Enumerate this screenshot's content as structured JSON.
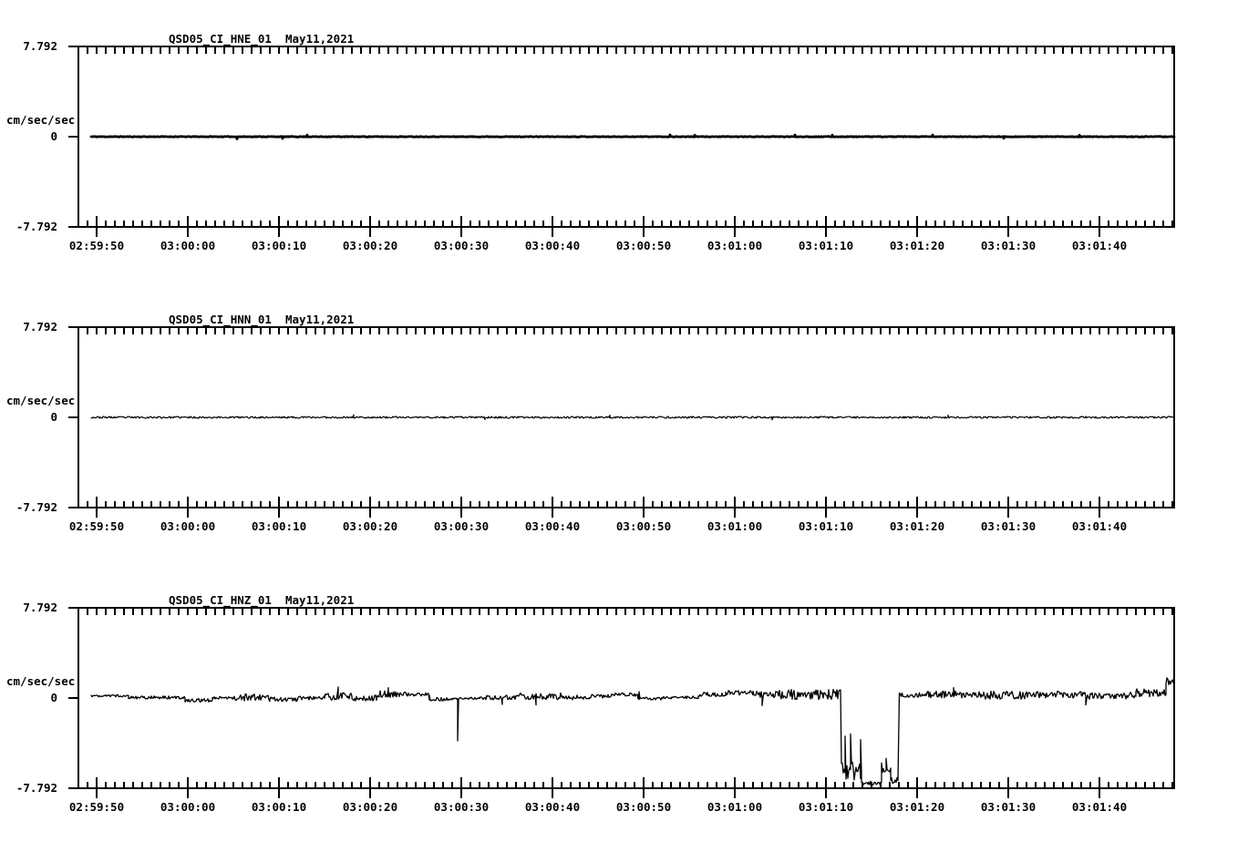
{
  "page": {
    "background": "#ffffff",
    "ink": "#000000"
  },
  "chart_data": [
    {
      "type": "line",
      "station_label": "QSD05_CI_HNE_01",
      "date_label": "May11,2021",
      "ylabel": "cm/sec/sec",
      "ylim": [
        -7.792,
        7.792
      ],
      "ytick_labels": [
        "7.792",
        "0",
        "-7.792"
      ],
      "x_tick_labels": [
        "02:59:50",
        "03:00:00",
        "03:00:10",
        "03:00:20",
        "03:00:30",
        "03:00:40",
        "03:00:50",
        "03:01:00",
        "03:01:10",
        "03:01:20",
        "03:01:30",
        "03:01:40"
      ],
      "x_axis": {
        "span_s": 120.2,
        "major_every_s": 10,
        "minor_every_s": 1,
        "first_major_offset_s": 2
      },
      "grid": false,
      "line_width": 2.8,
      "trace": {
        "segments": [
          [
            1.4,
            120.2,
            0.0,
            0.025
          ]
        ],
        "spikes": [
          [
            17.4,
            -0.2
          ],
          [
            22.4,
            -0.16
          ],
          [
            25.1,
            0.15
          ],
          [
            64.9,
            0.16
          ],
          [
            67.6,
            0.14
          ],
          [
            78.6,
            0.16
          ],
          [
            82.7,
            0.14
          ],
          [
            93.7,
            0.16
          ],
          [
            101.5,
            -0.14
          ],
          [
            109.8,
            0.13
          ]
        ]
      }
    },
    {
      "type": "line",
      "station_label": "QSD05_CI_HNN_01",
      "date_label": "May11,2021",
      "ylabel": "cm/sec/sec",
      "ylim": [
        -7.792,
        7.792
      ],
      "ytick_labels": [
        "7.792",
        "0",
        "-7.792"
      ],
      "x_tick_labels": [
        "02:59:50",
        "03:00:00",
        "03:00:10",
        "03:00:20",
        "03:00:30",
        "03:00:40",
        "03:00:50",
        "03:01:00",
        "03:01:10",
        "03:01:20",
        "03:01:30",
        "03:01:40"
      ],
      "x_axis": {
        "span_s": 120.2,
        "major_every_s": 10,
        "minor_every_s": 1,
        "first_major_offset_s": 2
      },
      "grid": false,
      "line_width": 1.2,
      "trace": {
        "segments": [
          [
            1.4,
            120.2,
            0.0,
            0.08
          ]
        ],
        "spikes": [
          [
            30.2,
            0.22
          ],
          [
            44.6,
            -0.2
          ],
          [
            58.3,
            0.2
          ],
          [
            76.1,
            -0.22
          ],
          [
            95.4,
            0.2
          ]
        ]
      }
    },
    {
      "type": "line",
      "station_label": "QSD05_CI_HNZ_01",
      "date_label": "May11,2021",
      "ylabel": "cm/sec/sec",
      "ylim": [
        -7.792,
        7.792
      ],
      "ytick_labels": [
        "7.792",
        "0",
        "-7.792"
      ],
      "x_tick_labels": [
        "02:59:50",
        "03:00:00",
        "03:00:10",
        "03:00:20",
        "03:00:30",
        "03:00:40",
        "03:00:50",
        "03:01:00",
        "03:01:10",
        "03:01:20",
        "03:01:30",
        "03:01:40"
      ],
      "x_axis": {
        "span_s": 120.2,
        "major_every_s": 10,
        "minor_every_s": 1,
        "first_major_offset_s": 2
      },
      "grid": false,
      "line_width": 1.3,
      "trace": {
        "segments": [
          [
            1.4,
            5.5,
            0.2,
            0.1
          ],
          [
            5.5,
            11.7,
            0.05,
            0.13
          ],
          [
            11.7,
            14.7,
            -0.2,
            0.15
          ],
          [
            14.7,
            17.0,
            0.0,
            0.12
          ],
          [
            17.0,
            21.0,
            0.05,
            0.3
          ],
          [
            21.0,
            24.0,
            -0.1,
            0.2
          ],
          [
            24.0,
            27.0,
            0.0,
            0.15
          ],
          [
            27.0,
            30.0,
            0.15,
            0.35
          ],
          [
            30.0,
            33.0,
            0.0,
            0.25
          ],
          [
            33.0,
            36.0,
            0.35,
            0.3
          ],
          [
            36.0,
            38.5,
            0.3,
            0.15
          ],
          [
            38.5,
            41.5,
            -0.1,
            0.15
          ],
          [
            41.5,
            44.0,
            -0.05,
            0.12
          ],
          [
            44.0,
            48.0,
            0.05,
            0.2
          ],
          [
            48.0,
            53.0,
            0.15,
            0.3
          ],
          [
            53.0,
            56.0,
            0.05,
            0.2
          ],
          [
            56.0,
            58.5,
            0.15,
            0.15
          ],
          [
            58.5,
            61.4,
            0.3,
            0.15
          ],
          [
            61.4,
            64.0,
            -0.05,
            0.12
          ],
          [
            64.0,
            68.0,
            0.05,
            0.12
          ],
          [
            68.0,
            71.0,
            0.3,
            0.2
          ],
          [
            71.0,
            74.0,
            0.45,
            0.2
          ],
          [
            74.0,
            76.5,
            0.3,
            0.3
          ],
          [
            76.5,
            83.6,
            0.3,
            0.45
          ],
          [
            83.7,
            85.9,
            -6.3,
            0.8
          ],
          [
            85.9,
            88.1,
            -7.35,
            0.18
          ],
          [
            88.1,
            89.1,
            -6.05,
            0.45
          ],
          [
            89.1,
            89.95,
            -7.15,
            0.3
          ],
          [
            90.05,
            93.0,
            0.25,
            0.2
          ],
          [
            93.0,
            99.0,
            0.3,
            0.3
          ],
          [
            99.0,
            104.0,
            0.25,
            0.35
          ],
          [
            104.0,
            110.0,
            0.3,
            0.3
          ],
          [
            110.0,
            116.0,
            0.2,
            0.3
          ],
          [
            116.0,
            119.3,
            0.45,
            0.35
          ],
          [
            119.3,
            120.2,
            1.5,
            0.55
          ]
        ],
        "spikes": [
          [
            28.5,
            0.95
          ],
          [
            34.0,
            0.9
          ],
          [
            41.6,
            -3.7
          ],
          [
            46.5,
            -0.55
          ],
          [
            50.2,
            -0.6
          ],
          [
            61.5,
            0.55
          ],
          [
            75.0,
            -0.65
          ],
          [
            84.1,
            -3.3
          ],
          [
            84.7,
            -3.1
          ],
          [
            85.8,
            -3.6
          ],
          [
            88.6,
            -5.2
          ],
          [
            96.0,
            0.9
          ],
          [
            110.5,
            -0.6
          ]
        ]
      }
    }
  ]
}
